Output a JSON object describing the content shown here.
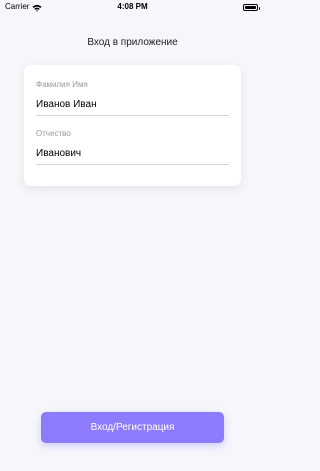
{
  "status_bar": {
    "carrier": "Carrier",
    "time": "4:08 PM",
    "wifi_icon": "wifi-icon",
    "battery_icon": "battery-icon"
  },
  "screen": {
    "title": "Вход в приложение"
  },
  "form": {
    "full_name": {
      "label": "Фамилия Имя",
      "value": "Иванов Иван"
    },
    "patronymic": {
      "label": "Отчество",
      "value": "Иванович"
    }
  },
  "actions": {
    "login_label": "Вход/Регистрация"
  },
  "colors": {
    "background": "#f6f7fa",
    "accent": "#8c7bfb"
  }
}
